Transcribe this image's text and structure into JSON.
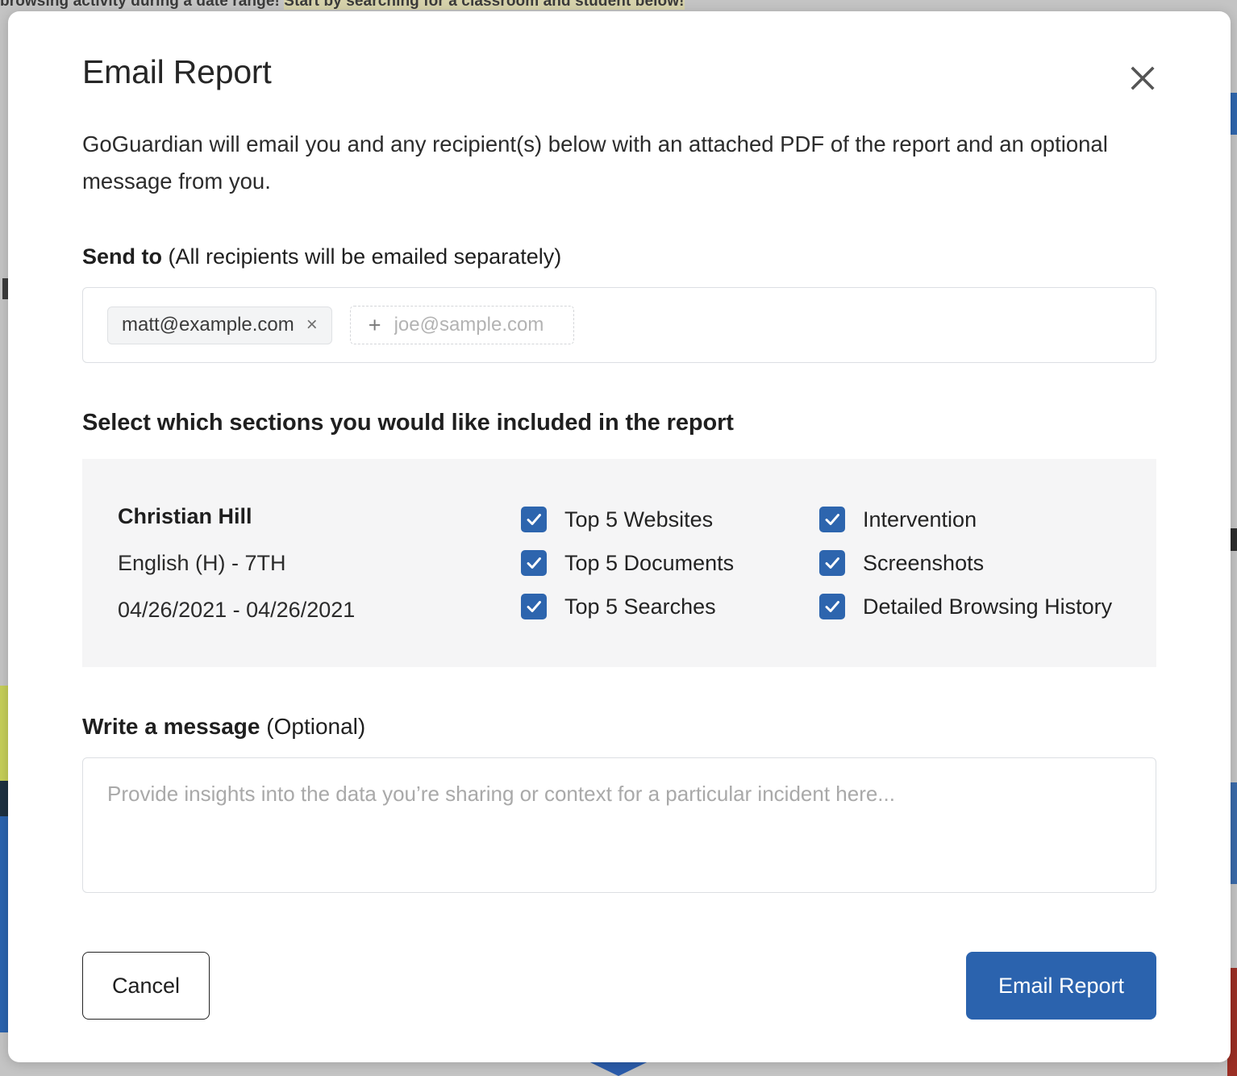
{
  "background": {
    "banner_text_plain": "browsing activity during a date range! ",
    "banner_text_highlight": "Start by searching for a classroom and student below!"
  },
  "modal": {
    "title": "Email Report",
    "close_icon": "close-icon",
    "intro": "GoGuardian will email you and any recipient(s) below with an attached PDF of the report and an optional message from you.",
    "send_to": {
      "label_strong": "Send to",
      "label_light": " (All recipients will be emailed separately)",
      "recipients": [
        {
          "email": "matt@example.com",
          "remove_icon": "×"
        }
      ],
      "add_placeholder": "joe@sample.com",
      "add_value": "",
      "plus_icon": "+"
    },
    "sections": {
      "heading": "Select which sections you would like included in the report",
      "student": {
        "name": "Christian Hill",
        "classroom": "English (H) - 7TH",
        "date_range": "04/26/2021 - 04/26/2021"
      },
      "column_1": [
        {
          "label": "Top 5 Websites",
          "checked": true
        },
        {
          "label": "Top 5 Documents",
          "checked": true
        },
        {
          "label": "Top 5 Searches",
          "checked": true
        }
      ],
      "column_2": [
        {
          "label": "Intervention",
          "checked": true
        },
        {
          "label": "Screenshots",
          "checked": true
        },
        {
          "label": "Detailed Browsing History",
          "checked": true
        }
      ]
    },
    "message": {
      "label_strong": "Write a message",
      "label_light": " (Optional)",
      "placeholder": "Provide insights into the data you’re sharing or context for a particular incident here...",
      "value": ""
    },
    "footer": {
      "cancel_label": "Cancel",
      "submit_label": "Email Report"
    }
  },
  "colors": {
    "accent_blue": "#2b63ae",
    "checkbox_blue": "#2d65ae",
    "panel_grey": "#f5f5f6",
    "page_grey": "#c4c4c4"
  }
}
